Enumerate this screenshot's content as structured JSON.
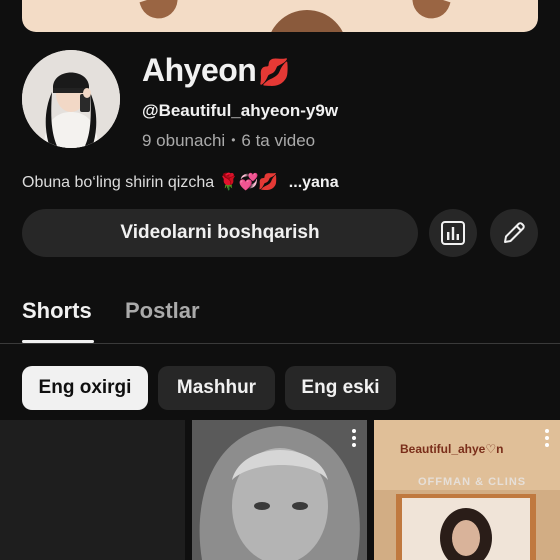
{
  "channel": {
    "name": "Ahyeon",
    "name_emoji": "💋",
    "handle": "@Beautiful_ahyeon-y9w",
    "subscribers": "9 obunachi",
    "separator": "•",
    "video_count": "6 ta video",
    "description": "Obuna bo‘ling shirin qizcha",
    "description_emojis": "🌹💞💋",
    "description_more": "...yana"
  },
  "actions": {
    "manage_label": "Videolarni boshqarish",
    "stats_icon": "bar-chart-icon",
    "edit_icon": "pencil-icon"
  },
  "tabs": [
    {
      "label": "Shorts",
      "active": true
    },
    {
      "label": "Postlar",
      "active": false
    }
  ],
  "filters": [
    {
      "label": "Eng oxirgi",
      "active": true
    },
    {
      "label": "Mashhur",
      "active": false
    },
    {
      "label": "Eng eski",
      "active": false
    }
  ],
  "thumbnails": {
    "third_title": "Beautiful_ahye♡n",
    "third_subtitle": "OFFMAN & CLINS"
  },
  "colors": {
    "background": "#0f0f0f",
    "surface": "#272727",
    "text_primary": "#f1f1f1",
    "text_secondary": "#aaaaaa",
    "banner": "#f3dcc6",
    "accent_red": "#e0262e"
  }
}
